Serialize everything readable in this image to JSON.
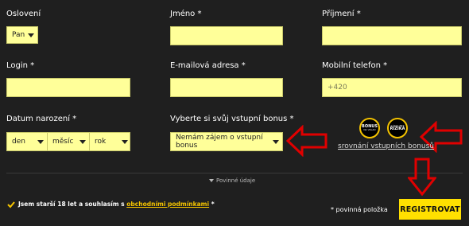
{
  "form": {
    "salutation": {
      "label": "Oslovení",
      "value": "Pan"
    },
    "first_name": {
      "label": "Jméno *",
      "value": ""
    },
    "last_name": {
      "label": "Příjmení *",
      "value": ""
    },
    "login": {
      "label": "Login *",
      "value": ""
    },
    "email": {
      "label": "E-mailová adresa *",
      "value": ""
    },
    "phone": {
      "label": "Mobilní telefon *",
      "placeholder": "+420"
    },
    "birth_date": {
      "label": "Datum narození *",
      "day": "den",
      "month": "měsíc",
      "year": "rok"
    },
    "bonus": {
      "label": "Vyberte si svůj vstupní bonus *",
      "value": "Nemám zájem o vstupní bonus"
    },
    "bonus_badges": [
      {
        "title": "BONUS",
        "subtitle": "NA VKLAD"
      },
      {
        "title": "RIZIKA",
        "subtitle": "SÁZKA BEZ"
      }
    ],
    "compare_link": "srovnání vstupních bonusů",
    "required_tab": "Povinné údaje",
    "terms": {
      "prefix": "Jsem starší 18 let a souhlasím s",
      "link": "obchodními podmínkami",
      "suffix": "*"
    },
    "required_note": "* povinná položka",
    "submit_label": "REGISTROVAT"
  },
  "colors": {
    "background": "#1f1f1f",
    "field": "#ffff99",
    "button": "#ffe000",
    "accent": "#f5c400",
    "arrow": "#e00000"
  },
  "icons": {
    "caret": "chevron-down-icon",
    "checkbox": "checkmark-icon",
    "arrows": "red-arrow-icon"
  }
}
